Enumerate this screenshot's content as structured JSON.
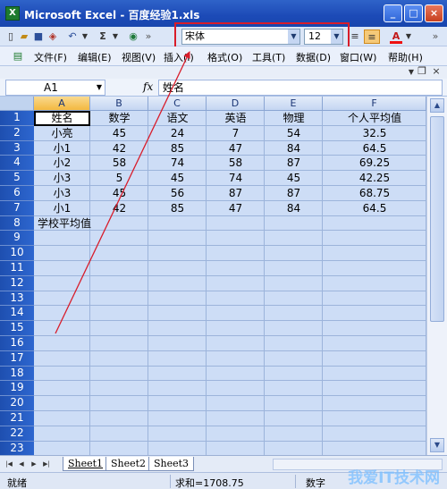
{
  "window": {
    "title": "Microsoft Excel - 百度经验1.xls",
    "minimize_label": "_",
    "maximize_label": "□",
    "close_label": "×"
  },
  "toolbar": {
    "sum_label": "Σ",
    "font_name": "宋体",
    "font_size": "12",
    "font_color_label": "A"
  },
  "menu": {
    "items": [
      "文件(F)",
      "编辑(E)",
      "视图(V)",
      "插入(I)",
      "格式(O)",
      "工具(T)",
      "数据(D)",
      "窗口(W)",
      "帮助(H)"
    ]
  },
  "formula_bar": {
    "cell_ref": "A1",
    "fx_label": "fx",
    "content": "姓名"
  },
  "grid": {
    "columns": [
      "A",
      "B",
      "C",
      "D",
      "E",
      "F"
    ],
    "row_numbers": [
      "1",
      "2",
      "3",
      "4",
      "5",
      "6",
      "7",
      "8",
      "9",
      "10",
      "11",
      "12",
      "13",
      "14",
      "15",
      "16",
      "17",
      "18",
      "19",
      "20",
      "21",
      "22",
      "23"
    ],
    "rows": [
      [
        "姓名",
        "数学",
        "语文",
        "英语",
        "物理",
        "个人平均值"
      ],
      [
        "小亮",
        "45",
        "24",
        "7",
        "54",
        "32.5"
      ],
      [
        "小1",
        "42",
        "85",
        "47",
        "84",
        "64.5"
      ],
      [
        "小2",
        "58",
        "74",
        "58",
        "87",
        "69.25"
      ],
      [
        "小3",
        "5",
        "45",
        "74",
        "45",
        "42.25"
      ],
      [
        "小3",
        "45",
        "56",
        "87",
        "87",
        "68.75"
      ],
      [
        "小1",
        "42",
        "85",
        "47",
        "84",
        "64.5"
      ],
      [
        "学校平均值",
        "",
        "",
        "",
        "",
        ""
      ]
    ]
  },
  "sheets": {
    "tabs": [
      "Sheet1",
      "Sheet2",
      "Sheet3"
    ],
    "active": "Sheet1"
  },
  "status": {
    "ready": "就绪",
    "sum": "求和=1708.75",
    "mode": "数字"
  },
  "watermark": "我爱IT技术网",
  "colors": {
    "highlight_box": "#d81c2a",
    "arrow": "#d81c2a",
    "row_header": "#1e4fb0",
    "cell_fill": "#cdddf6"
  }
}
